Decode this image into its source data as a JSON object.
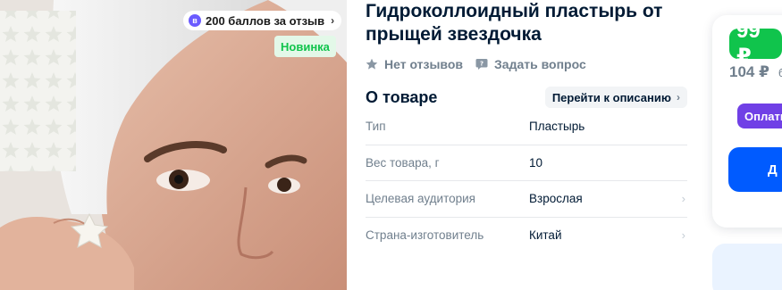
{
  "photo": {
    "points_badge": "200 баллов за отзыв",
    "points_icon": "в",
    "new_badge": "Новинка",
    "alt": "Гидроколлоидный пластырь от прыщей звездочка"
  },
  "product": {
    "title": "Гидроколлоидный пластырь от прыщей звездочка",
    "reviews": "Нет отзывов",
    "ask_question": "Задать вопрос"
  },
  "about": {
    "title": "О товаре",
    "goto_description": "Перейти к описанию",
    "specs": [
      {
        "key": "Тип",
        "value": "Пластырь"
      },
      {
        "key": "Вес товара, г",
        "value": "10"
      },
      {
        "key": "Целевая аудитория",
        "value": "Взрослая"
      },
      {
        "key": "Страна-изготовитель",
        "value": "Китай"
      }
    ]
  },
  "price": {
    "current": "99 ₽",
    "old": "104 ₽",
    "old_suffix": "б",
    "pay_button": "Оплати",
    "cart_button": "Д"
  },
  "colors": {
    "accent_green": "#10c44c",
    "accent_blue": "#005bff",
    "accent_purple": "#7040e6",
    "muted_text": "#707f8d"
  },
  "icons": {
    "star": "star-icon",
    "question": "question-bubble-icon",
    "chevron": "chevron-right-icon"
  }
}
